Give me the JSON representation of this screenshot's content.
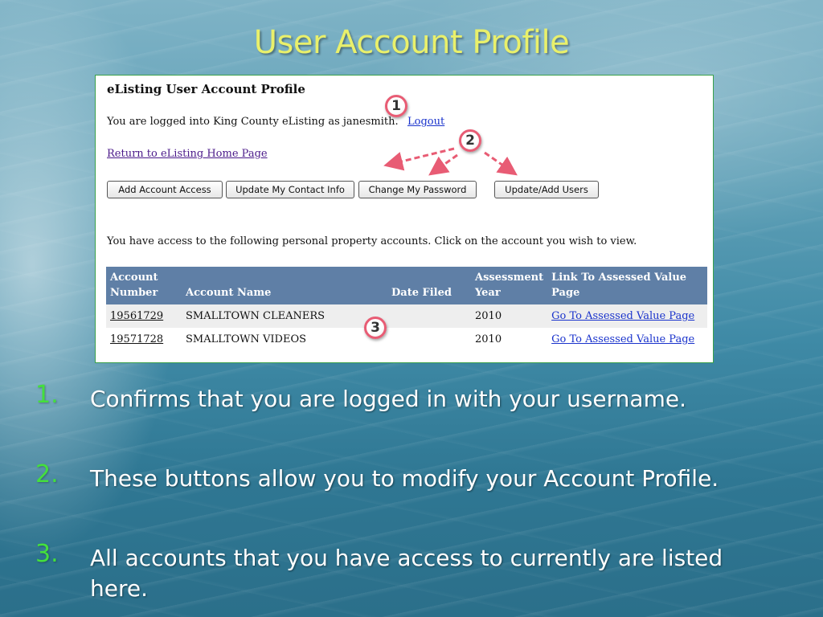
{
  "slide": {
    "title": "User Account Profile"
  },
  "screenshot": {
    "title": "eListing User Account Profile",
    "logged_in_text": "You are logged into King County eListing as janesmith.",
    "logout_label": "Logout",
    "return_link": "Return to eListing Home Page",
    "buttons": {
      "add_account_access": "Add Account Access",
      "update_contact_info": "Update My Contact Info",
      "change_password": "Change My Password",
      "update_add_users": "Update/Add Users"
    },
    "access_text": "You have access to the following personal property accounts. Click on the account you wish to view.",
    "table": {
      "headers": {
        "account_number_1": "Account",
        "account_number_2": "Number",
        "account_name": "Account Name",
        "date_filed": "Date Filed",
        "assessment_year_1": "Assessment",
        "assessment_year_2": "Year",
        "link_1": "Link To Assessed Value",
        "link_2": "Page"
      },
      "rows": [
        {
          "account_number": "19561729",
          "account_name": "SMALLTOWN CLEANERS",
          "date_filed": "",
          "assessment_year": "2010",
          "link": "Go To Assessed Value Page"
        },
        {
          "account_number": "19571728",
          "account_name": "SMALLTOWN VIDEOS",
          "date_filed": "",
          "assessment_year": "2010",
          "link": "Go To Assessed Value Page"
        }
      ]
    }
  },
  "callouts": [
    "1",
    "2",
    "3"
  ],
  "bullets": [
    {
      "num": "1.",
      "text": "Confirms that you are logged in with your username."
    },
    {
      "num": "2.",
      "text": "These buttons allow you to modify your Account Profile."
    },
    {
      "num": "3.",
      "text": "All accounts that you have access to currently are listed here."
    }
  ],
  "colors": {
    "title": "#e9f06b",
    "bullet_number": "#44e03c",
    "callout_ring": "#e85c74",
    "table_header": "#5f7fa6"
  }
}
